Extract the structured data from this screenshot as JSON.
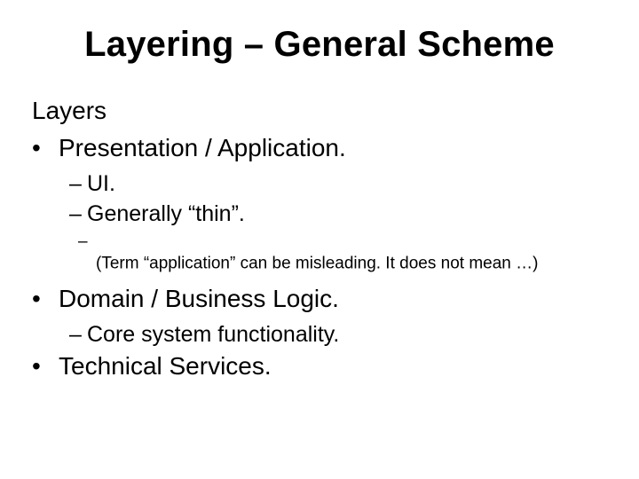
{
  "title": "Layering – General Scheme",
  "body": {
    "heading": "Layers",
    "items": [
      {
        "label": "Presentation / Application.",
        "sub": [
          {
            "label": "UI."
          },
          {
            "label": "Generally “thin”."
          }
        ],
        "subsub": [
          {
            "label": "(Term “application” can be misleading. It does not mean …)"
          }
        ]
      },
      {
        "label": "Domain / Business Logic.",
        "sub": [
          {
            "label": "Core system functionality."
          }
        ]
      },
      {
        "label": "Technical Services."
      }
    ]
  }
}
